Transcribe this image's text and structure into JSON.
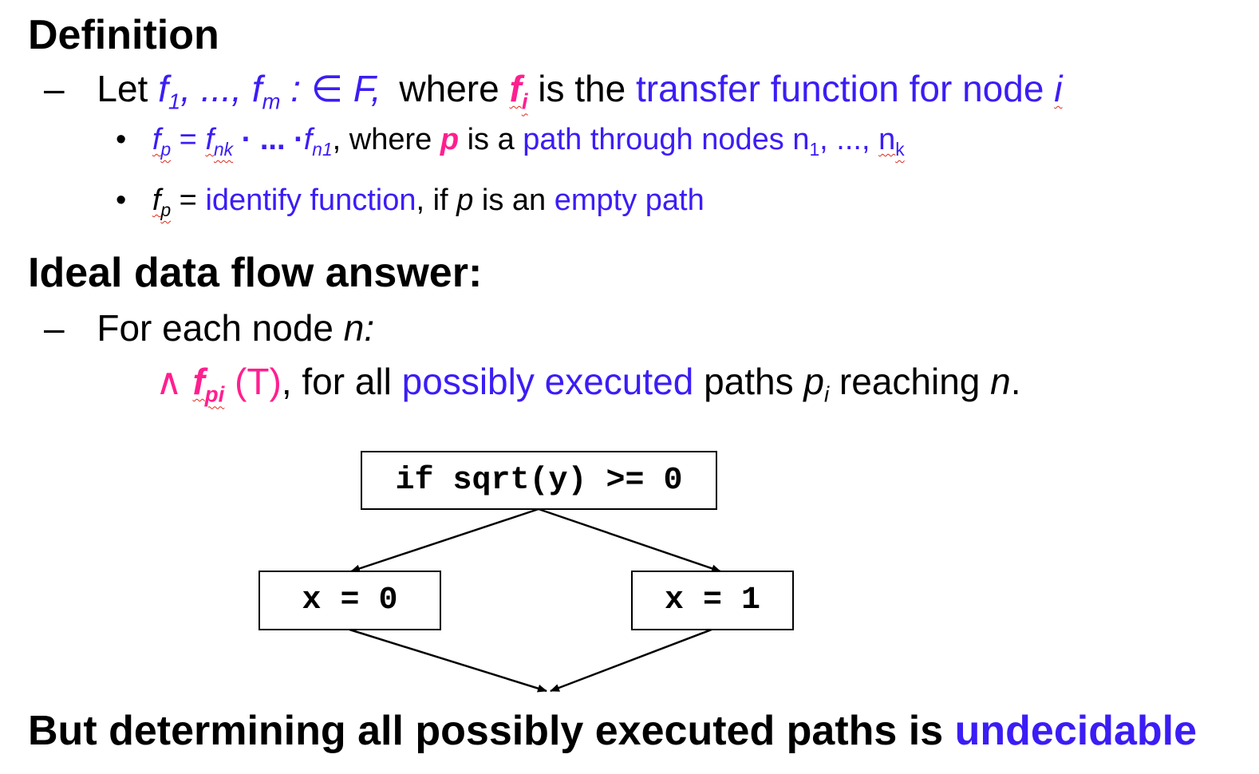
{
  "heading_definition": "Definition",
  "def_line": {
    "dash": "–",
    "let": "Let",
    "f": "f",
    "sub_1": "1",
    "sep": ", ..., ",
    "sub_m": "m",
    "in_F": " : ∈ F,",
    "where": "where",
    "fi_f": "f",
    "fi_sub": "i",
    "is_the": "is the",
    "transfer": "transfer function for node",
    "node_i": "i"
  },
  "bullet1": {
    "bullet": "•",
    "fp_f": "f",
    "fp_sub": "p",
    "eq": " = ",
    "fnk_f": "f",
    "fnk_sub": "nk",
    "dots": " · ... ·",
    "fn1_f": "f",
    "fn1_sub": "n1",
    "where": ", where ",
    "p": "p",
    "is_a": " is a ",
    "path_text": "path through nodes n",
    "n1_sub": "1",
    "path_mid": ", ..., ",
    "nk": "n",
    "nk_sub": "k"
  },
  "bullet2": {
    "bullet": "•",
    "fp_f": "f",
    "fp_sub": "p",
    "eq": " = ",
    "identify": "identify function",
    "if": ", if ",
    "p": "p",
    "is_an": " is an ",
    "empty": "empty path"
  },
  "heading_ideal": "Ideal data flow answer:",
  "for_each": {
    "dash": "–",
    "text": "For each node ",
    "n": "n:"
  },
  "meet_line": {
    "wedge": "∧",
    "f": "f",
    "sub": "pi",
    "top": " (T)",
    "comma": ", for all ",
    "possibly": "possibly executed",
    "paths": " paths ",
    "p": "p",
    "p_sub": "i",
    "reaching": " reaching ",
    "n": "n",
    "period": "."
  },
  "flow": {
    "top_box": "if sqrt(y) >= 0",
    "left_box": "x = 0",
    "right_box": "x = 1"
  },
  "conclusion": {
    "text": "But determining all possibly executed paths is ",
    "undecidable": "undecidable"
  },
  "colors": {
    "blue": "#3b1df5",
    "pink": "#ff1f8f"
  }
}
